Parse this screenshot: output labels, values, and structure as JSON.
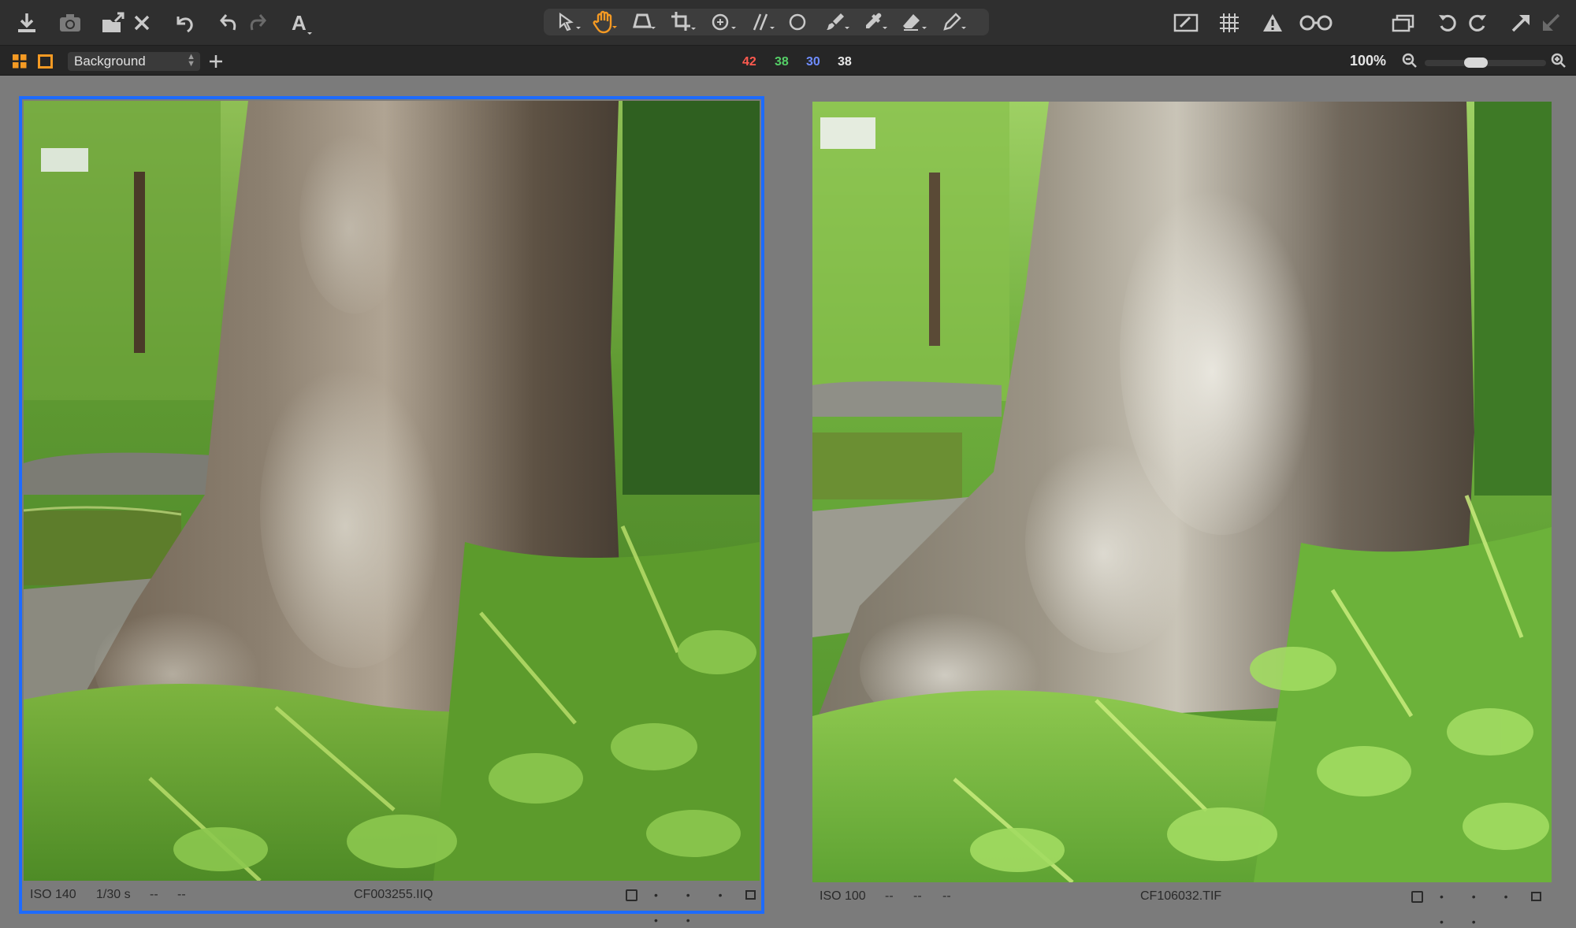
{
  "toolbar": {
    "left_icons": [
      "import-icon",
      "camera-icon",
      "export-icon",
      "delete-icon",
      "undo-history-icon",
      "undo-icon",
      "redo-icon",
      "text-icon"
    ],
    "cursor_tools": [
      "select-arrow-icon",
      "pan-hand-icon",
      "keystone-icon",
      "crop-icon",
      "rotate-icon",
      "straighten-icon",
      "circle-icon",
      "brush-icon",
      "picker-icon",
      "eraser-icon",
      "gradient-icon"
    ],
    "right_icons": [
      "edit-mask-icon",
      "grid-icon",
      "warning-icon",
      "glasses-icon",
      "windows-icon",
      "rotate-left-icon",
      "rotate-right-icon",
      "expand-icon",
      "collapse-icon"
    ],
    "active_tool_color": "#f59a23"
  },
  "subbar": {
    "layer_name": "Background",
    "rgb": {
      "r": "42",
      "g": "38",
      "b": "30",
      "l": "38"
    },
    "rgb_colors": {
      "r": "#ff5a4f",
      "g": "#55d067",
      "b": "#6f8dff",
      "l": "#e8e8e8"
    },
    "zoom": "100%",
    "zoom_level": 0.4
  },
  "viewer": {
    "selected_border_color": "#1d6bff",
    "left": {
      "iso": "ISO 140",
      "shutter": "1/30 s",
      "aperture": "--",
      "focal": "--",
      "filename": "CF003255.IIQ",
      "rating_dots": "• • • • •"
    },
    "right": {
      "iso": "ISO 100",
      "shutter": "--",
      "aperture": "--",
      "focal": "--",
      "filename": "CF106032.TIF",
      "rating_dots": "• • • • •"
    }
  }
}
